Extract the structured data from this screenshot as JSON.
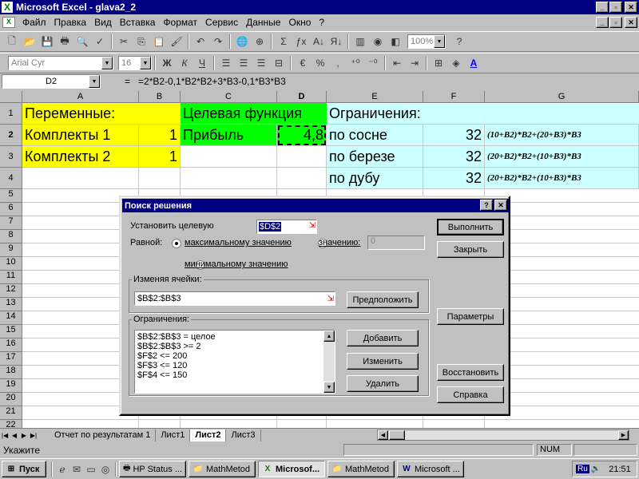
{
  "window": {
    "title": "Microsoft Excel - glava2_2",
    "min": "_",
    "max": "▫",
    "close": "✕"
  },
  "menu": [
    "Файл",
    "Правка",
    "Вид",
    "Вставка",
    "Формат",
    "Сервис",
    "Данные",
    "Окно",
    "?"
  ],
  "toolbar": {
    "zoom": "100%",
    "font": "Arial Cyr",
    "size": "16"
  },
  "formula_bar": {
    "name_box": "D2",
    "equals": "=",
    "formula": "=2*B2-0,1*B2*B2+3*B3-0,1*B3*B3"
  },
  "columns": [
    "A",
    "B",
    "C",
    "D",
    "E",
    "F",
    "G"
  ],
  "rows": [
    "1",
    "2",
    "3",
    "4",
    "5",
    "6",
    "7",
    "8",
    "9",
    "10",
    "11",
    "12",
    "13",
    "14",
    "15",
    "16",
    "17",
    "18",
    "19",
    "20",
    "21",
    "22"
  ],
  "cells": {
    "A1": "Переменные:",
    "C1": "Целевая функция",
    "E1": "Ограничения:",
    "A2": "Комплекты 1",
    "B2": "1",
    "C2": "Прибыль",
    "D2": "4,8",
    "E2": "по сосне",
    "F2": "32",
    "G2": "(10+B2)*B2+(20+B3)*B3",
    "A3": "Комплекты 2",
    "B3": "1",
    "E3": "по березе",
    "F3": "32",
    "G3": "(20+B2)*B2+(10+B3)*B3",
    "E4": "по дубу",
    "F4": "32",
    "G4": "(20+B2)*B2+(10+B3)*B3"
  },
  "colors": {
    "yellow": "#ffff00",
    "green": "#00ff00",
    "cyan": "#ccffff",
    "title_blue": "#000080"
  },
  "dialog": {
    "title": "Поиск решения",
    "help": "?",
    "close": "✕",
    "target_label": "Установить целевую",
    "target_value": "$D$2",
    "equal_label": "Равной:",
    "opt_max": "максимальному значению",
    "opt_value": "значению:",
    "value_field": "0",
    "opt_min": "минимальному значению",
    "changing_label": "Изменяя ячейки:",
    "changing_value": "$B$2:$B$3",
    "guess_btn": "Предположить",
    "constraints_label": "Ограничения:",
    "constraints": [
      "$B$2:$B$3 = целое",
      "$B$2:$B$3 >= 2",
      "$F$2 <= 200",
      "$F$3 <= 120",
      "$F$4 <= 150"
    ],
    "add_btn": "Добавить",
    "change_btn": "Изменить",
    "delete_btn": "Удалить",
    "solve_btn": "Выполнить",
    "close_btn": "Закрыть",
    "options_btn": "Параметры",
    "reset_btn": "Восстановить",
    "help_btn": "Справка"
  },
  "sheet_tabs": [
    "Отчет по результатам 1",
    "Лист1",
    "Лист2",
    "Лист3"
  ],
  "active_tab": "Лист2",
  "status": {
    "text": "Укажите",
    "num": "NUM"
  },
  "taskbar": {
    "start": "Пуск",
    "tasks": [
      "HP Status ...",
      "MathMetod",
      "Microsof...",
      "MathMetod",
      "Microsoft ..."
    ],
    "lang": "Ru",
    "clock": "21:51"
  }
}
